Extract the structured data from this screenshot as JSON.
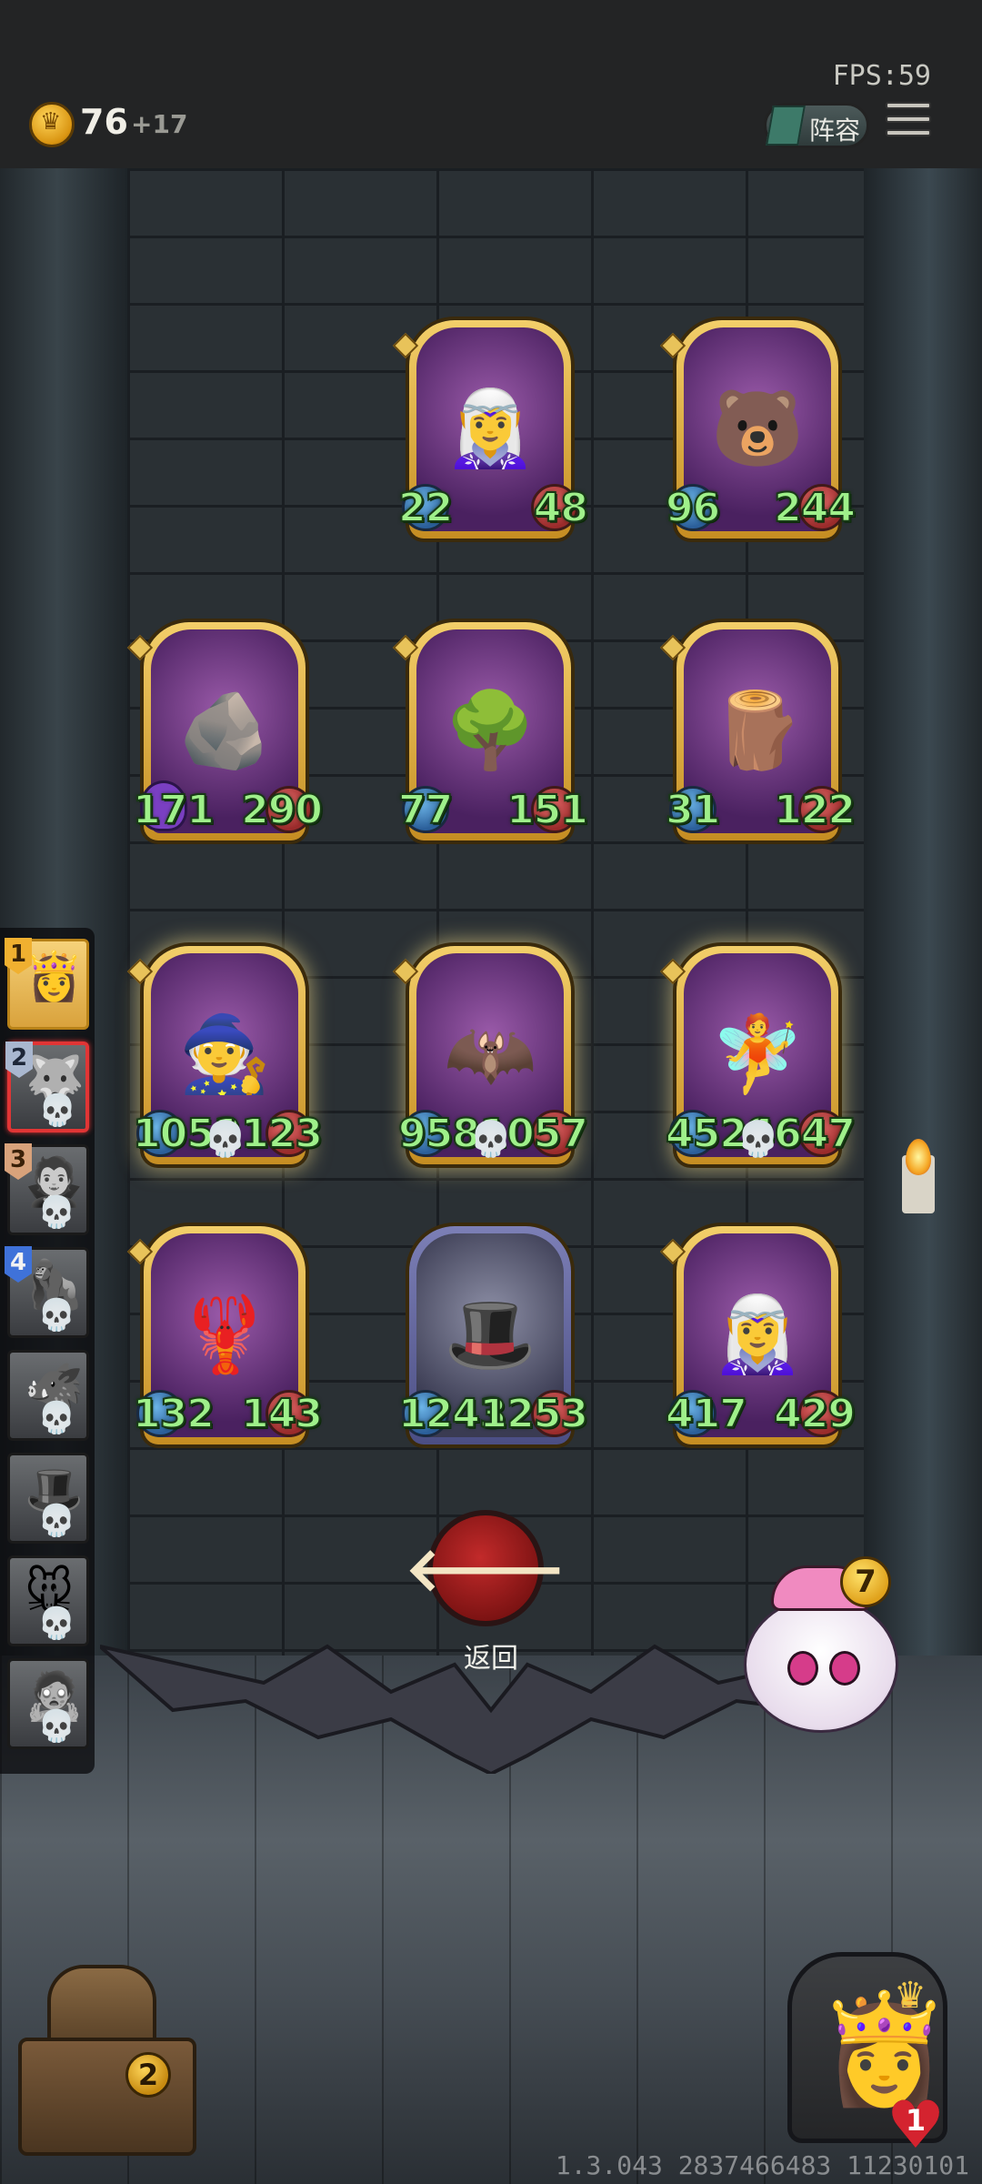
{
  "header": {
    "fps": "FPS:59",
    "gold": "76",
    "gold_increment": "+17",
    "lineup_label": "阵容"
  },
  "board": {
    "heroes": [
      {
        "row": 0,
        "col": 1,
        "face": "🧝‍♀️",
        "attack": "22",
        "health": "48",
        "frame": "gold",
        "glow": false,
        "tribe": false,
        "skull": false
      },
      {
        "row": 0,
        "col": 2,
        "face": "🐻",
        "attack": "96",
        "health": "244",
        "frame": "gold",
        "glow": false,
        "tribe": false,
        "skull": false
      },
      {
        "row": 1,
        "col": 0,
        "face": "🪨",
        "attack": "171",
        "health": "290",
        "frame": "gold",
        "glow": false,
        "tribe": true,
        "skull": false
      },
      {
        "row": 1,
        "col": 1,
        "face": "🌳",
        "attack": "77",
        "health": "151",
        "frame": "gold",
        "glow": false,
        "tribe": false,
        "skull": false
      },
      {
        "row": 1,
        "col": 2,
        "face": "🪵",
        "attack": "31",
        "health": "122",
        "frame": "gold",
        "glow": false,
        "tribe": false,
        "skull": false
      },
      {
        "row": 2,
        "col": 0,
        "face": "🧙",
        "attack": "1053",
        "health": "1123",
        "frame": "gold",
        "glow": true,
        "tribe": false,
        "skull": true
      },
      {
        "row": 2,
        "col": 1,
        "face": "🦇",
        "attack": "958",
        "health": "1057",
        "frame": "gold",
        "glow": true,
        "tribe": false,
        "skull": true
      },
      {
        "row": 2,
        "col": 2,
        "face": "🧚",
        "attack": "4529",
        "health": "4647",
        "frame": "gold",
        "glow": true,
        "tribe": false,
        "skull": true
      },
      {
        "row": 3,
        "col": 0,
        "face": "🦞",
        "attack": "132",
        "health": "143",
        "frame": "gold",
        "glow": false,
        "tribe": false,
        "skull": false
      },
      {
        "row": 3,
        "col": 1,
        "face": "🎩",
        "attack": "1243",
        "health": "1253",
        "frame": "silver",
        "glow": false,
        "tribe": false,
        "skull": false
      },
      {
        "row": 3,
        "col": 2,
        "face": "🧝‍♀️",
        "attack": "417",
        "health": "429",
        "frame": "gold",
        "glow": false,
        "tribe": false,
        "skull": false
      }
    ]
  },
  "sidebar": {
    "players": [
      {
        "rank": "1",
        "face": "👸",
        "active": true,
        "selected": false,
        "skull": false
      },
      {
        "rank": "2",
        "face": "🐺",
        "active": false,
        "selected": true,
        "skull": true
      },
      {
        "rank": "3",
        "face": "🧛",
        "active": false,
        "selected": false,
        "skull": true
      },
      {
        "rank": "4",
        "face": "🦍",
        "active": false,
        "selected": false,
        "skull": true
      },
      {
        "rank": "",
        "face": "🐗",
        "active": false,
        "selected": false,
        "skull": true
      },
      {
        "rank": "",
        "face": "🎩",
        "active": false,
        "selected": false,
        "skull": true
      },
      {
        "rank": "",
        "face": "🐭",
        "active": false,
        "selected": false,
        "skull": true
      },
      {
        "rank": "",
        "face": "🧟",
        "active": false,
        "selected": false,
        "skull": true
      }
    ]
  },
  "back": {
    "label": "返回"
  },
  "mascot": {
    "level": "7"
  },
  "chest": {
    "count": "2"
  },
  "player": {
    "lives": "1"
  },
  "footer": {
    "version": "1.3.043 2837466483 11230101"
  }
}
